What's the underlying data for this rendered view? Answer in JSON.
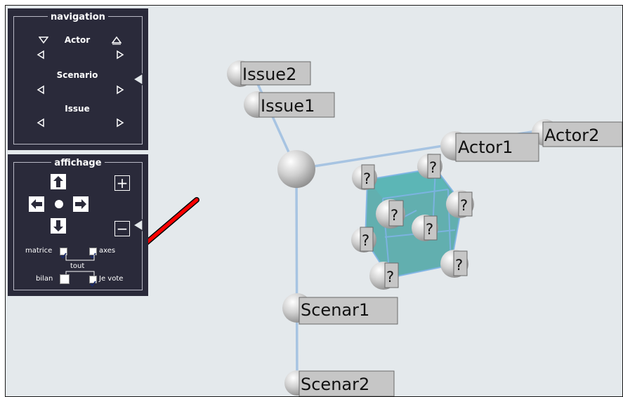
{
  "navigation": {
    "title": "navigation",
    "actor_label": "Actor",
    "scenario_label": "Scenario",
    "issue_label": "Issue"
  },
  "affichage": {
    "title": "affichage",
    "plus_label": "+",
    "minus_label": "−",
    "matrice_label": "matrice",
    "axes_label": "axes",
    "tout_label": "tout",
    "bilan_label": "bilan",
    "jevote_label": "Je vote",
    "matrice_checked": true,
    "axes_checked": true,
    "bilan_checked": false,
    "jevote_checked": true
  },
  "scene": {
    "nodes": {
      "issue2": "Issue2",
      "issue1": "Issue1",
      "actor1": "Actor1",
      "actor2": "Actor2",
      "scenar1": "Scenar1",
      "scenar2": "Scenar2"
    },
    "question_mark": "?",
    "colors": {
      "background": "#e4e9ec",
      "panel": "#2a2a3a",
      "axis_line": "#a7c4e2",
      "cube_fill": "#4ba5a5",
      "arrow": "#ff0000"
    }
  }
}
